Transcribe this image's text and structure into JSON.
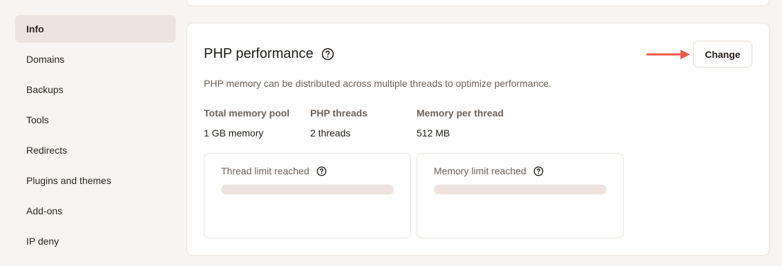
{
  "sidebar": {
    "items": [
      {
        "label": "Info",
        "active": true
      },
      {
        "label": "Domains"
      },
      {
        "label": "Backups"
      },
      {
        "label": "Tools"
      },
      {
        "label": "Redirects"
      },
      {
        "label": "Plugins and themes"
      },
      {
        "label": "Add-ons"
      },
      {
        "label": "IP deny"
      }
    ]
  },
  "php": {
    "title": "PHP performance",
    "change_label": "Change",
    "description": "PHP memory can be distributed across multiple threads to optimize performance.",
    "stats": [
      {
        "label": "Total memory pool",
        "value": "1 GB memory"
      },
      {
        "label": "PHP threads",
        "value": "2 threads"
      },
      {
        "label": "Memory per thread",
        "value": "512 MB"
      }
    ],
    "limits": [
      {
        "title": "Thread limit reached"
      },
      {
        "title": "Memory limit reached"
      }
    ]
  },
  "colors": {
    "accent_arrow": "#ef5a4a",
    "active_nav_bg": "#ede4dd",
    "skeleton_bar": "#eee3de"
  },
  "icons": {
    "help": "question-circle-icon",
    "arrow": "arrow-right-icon"
  }
}
